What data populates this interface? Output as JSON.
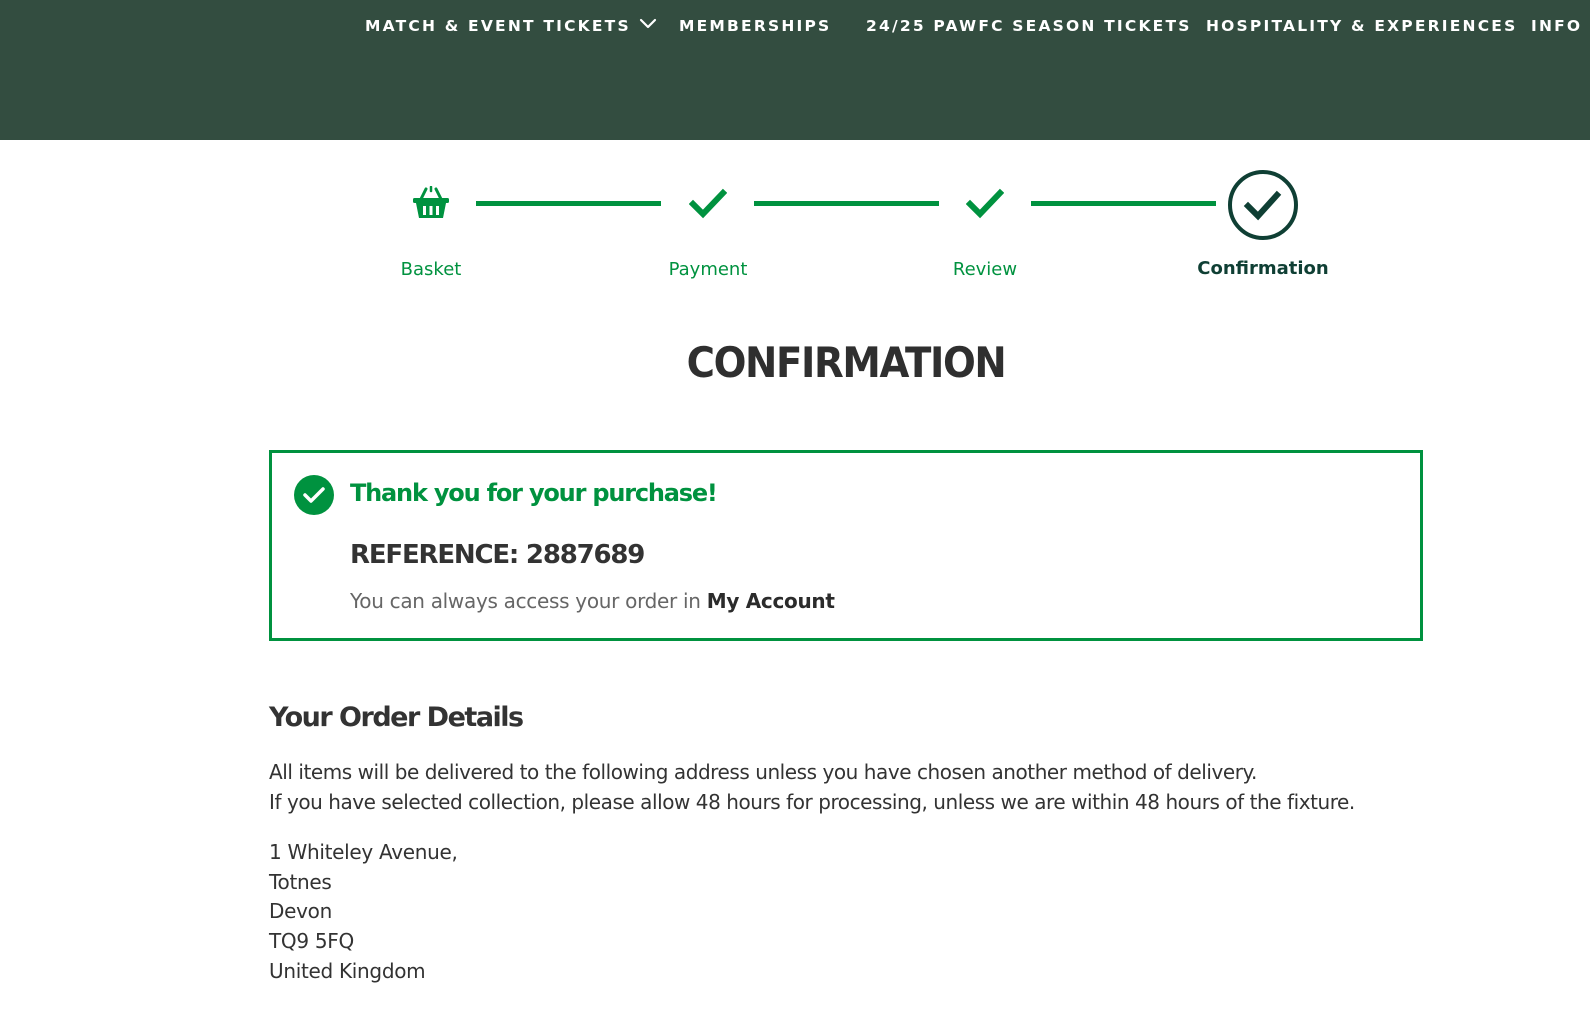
{
  "nav": {
    "items": [
      {
        "label": "MATCH & EVENT TICKETS",
        "has_dropdown": true,
        "icon": "chevron-down-icon"
      },
      {
        "label": "MEMBERSHIPS"
      },
      {
        "label": "24/25 PAWFC SEASON TICKETS"
      },
      {
        "label": "HOSPITALITY & EXPERIENCES"
      },
      {
        "label": "INFO"
      }
    ]
  },
  "stepper": {
    "steps": [
      {
        "label": "Basket",
        "icon": "basket-icon",
        "state": "complete"
      },
      {
        "label": "Payment",
        "icon": "checkmark-icon",
        "state": "complete"
      },
      {
        "label": "Review",
        "icon": "checkmark-icon",
        "state": "complete"
      },
      {
        "label": "Confirmation",
        "icon": "checkmark-circle-icon",
        "state": "current"
      }
    ]
  },
  "page": {
    "title": "CONFIRMATION"
  },
  "confirmation": {
    "icon": "check-circle-icon",
    "message": "Thank you for your purchase!",
    "reference": "REFERENCE: 2887689",
    "access_text": "You can always access your order in ",
    "account_link": "My Account"
  },
  "order_details": {
    "heading": "Your Order Details",
    "line1": "All items will be delivered to the following address unless you have chosen another method of delivery.",
    "line2": "If you have selected collection, please allow 48 hours for processing, unless we are within 48 hours of the fixture.",
    "address": [
      "1 Whiteley Avenue,",
      "Totnes",
      "Devon",
      "TQ9 5FQ",
      "United Kingdom"
    ]
  },
  "colors": {
    "header_bg": "#334d40",
    "accent_green": "#00923f",
    "dark_green": "#0f3f34",
    "text": "#333333",
    "muted_text": "#666666"
  }
}
